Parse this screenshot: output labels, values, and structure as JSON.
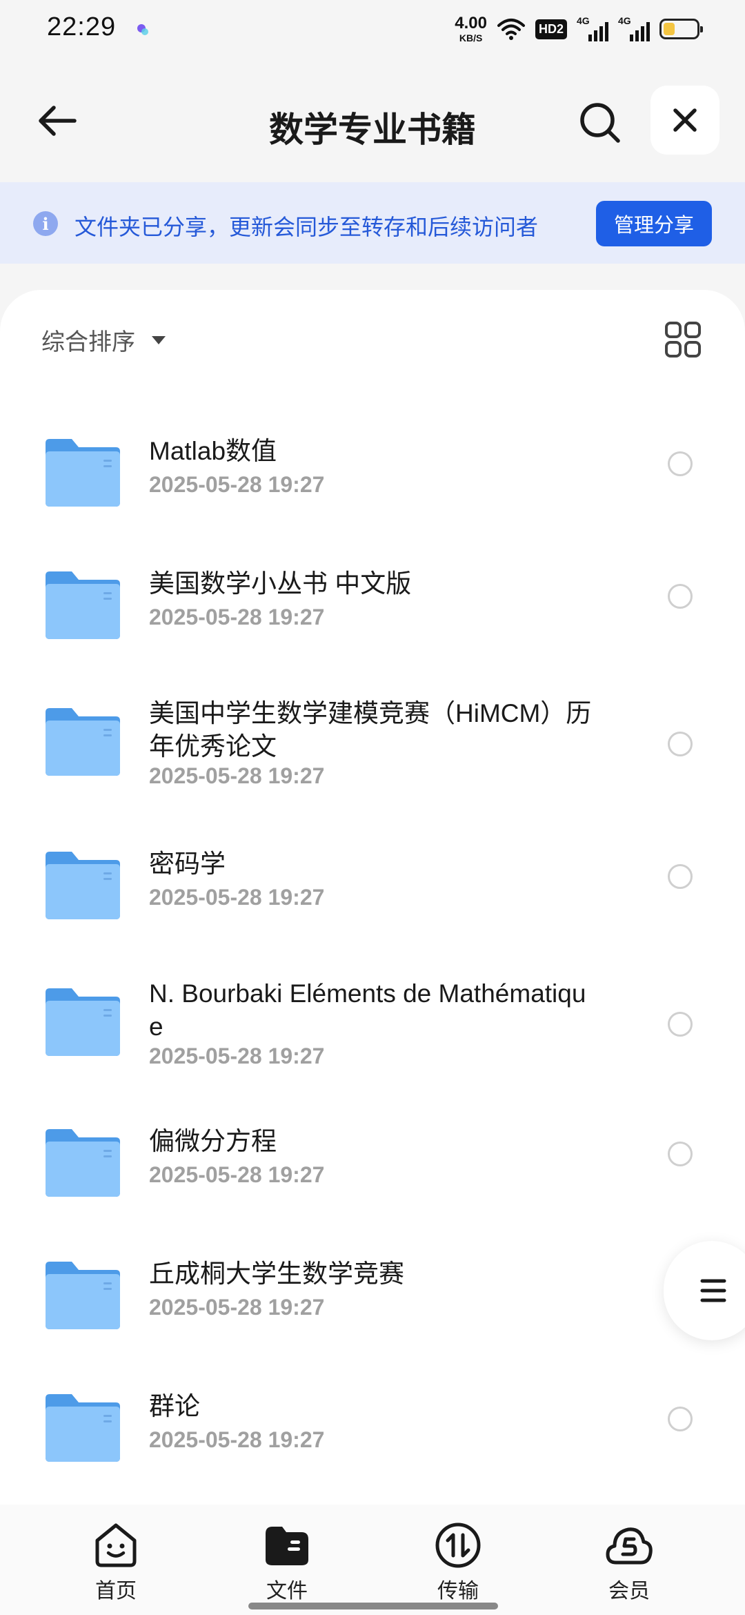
{
  "status_bar": {
    "time": "22:29",
    "net_speed_value": "4.00",
    "net_speed_unit": "KB/S",
    "hd_badge": "HD2",
    "sim1_label": "4G",
    "sim2_label": "4G",
    "battery_level": 0.35
  },
  "header": {
    "title": "数学专业书籍",
    "back_icon": "arrow-left-icon",
    "search_icon": "search-icon",
    "close_icon": "close-icon"
  },
  "banner": {
    "text": "文件夹已分享，更新会同步至转存和后续访问者",
    "button_label": "管理分享",
    "icon": "info-icon"
  },
  "toolbar": {
    "sort_label": "综合排序",
    "view_icon": "grid-view-icon"
  },
  "files": [
    {
      "name": "Matlab数值",
      "date": "2025-05-28 19:27"
    },
    {
      "name": "美国数学小丛书 中文版",
      "date": "2025-05-28 19:27"
    },
    {
      "name": "美国中学生数学建模竞赛（HiMCM）历年优秀论文",
      "date": "2025-05-28 19:27"
    },
    {
      "name": "密码学",
      "date": "2025-05-28 19:27"
    },
    {
      "name": "N. Bourbaki Eléments de Mathématique",
      "date": "2025-05-28 19:27"
    },
    {
      "name": "偏微分方程",
      "date": "2025-05-28 19:27"
    },
    {
      "name": "丘成桐大学生数学竞赛",
      "date": "2025-05-28 19:27"
    },
    {
      "name": "群论",
      "date": "2025-05-28 19:27"
    }
  ],
  "bottom_nav": [
    {
      "label": "首页",
      "icon": "home-face-icon"
    },
    {
      "label": "文件",
      "icon": "folder-icon",
      "active": true
    },
    {
      "label": "传输",
      "icon": "transfer-icon"
    },
    {
      "label": "会员",
      "icon": "vip-cloud-icon"
    }
  ],
  "colors": {
    "accent": "#1f5fe6",
    "banner_bg": "#e7ecfb",
    "banner_text": "#2559d8",
    "folder": "#64aef5"
  }
}
